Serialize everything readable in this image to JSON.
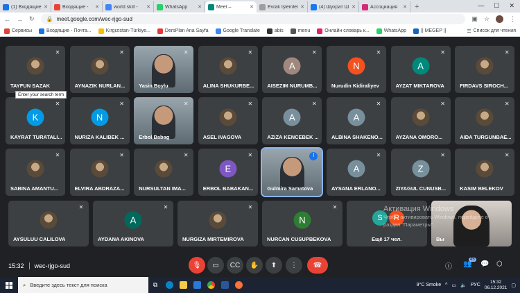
{
  "browser": {
    "tabs": [
      {
        "label": "(1) Входящие - ",
        "color": "#1a73e8"
      },
      {
        "label": "Входящие - ",
        "color": "#ea4335"
      },
      {
        "label": "world skill - ",
        "color": "#4285f4"
      },
      {
        "label": "WhatsApp",
        "color": "#25d366"
      },
      {
        "label": "Meet – ",
        "color": "#00897b",
        "active": true
      },
      {
        "label": "Evrak İşlemleri",
        "color": "#9e9e9e"
      },
      {
        "label": "(4) Шухрат Ш...",
        "color": "#1877f2"
      },
      {
        "label": "Ассоциация ",
        "color": "#d62976"
      }
    ],
    "address": "meet.google.com/wec-rjgo-sud",
    "bookmarks": [
      {
        "label": "Сервисы",
        "color": "#db4437"
      },
      {
        "label": "Входящие - Почта...",
        "color": "#1a73e8"
      },
      {
        "label": "Kırgızistan-Türkiye...",
        "color": "#fbbc04"
      },
      {
        "label": "DersPlan Ana Sayfa",
        "color": "#e53935"
      },
      {
        "label": "Google Translate",
        "color": "#4285f4"
      },
      {
        "label": "abis",
        "color": "#333333"
      },
      {
        "label": "menu",
        "color": "#555555"
      },
      {
        "label": "Онлайн словарь к...",
        "color": "#e91e63"
      },
      {
        "label": "WhatsApp",
        "color": "#25d366"
      },
      {
        "label": "|| MEGEP ||",
        "color": "#1565c0"
      }
    ],
    "reading_list": "Список для чтения"
  },
  "tooltip": "Enter your search term",
  "participants": [
    {
      "name": "TAYFUN SAZAK",
      "type": "photo"
    },
    {
      "name": "AYNAZIK NURLAN...",
      "type": "photo"
    },
    {
      "name": "Yasin Boylu",
      "type": "video"
    },
    {
      "name": "ALINA SHUKURBE...",
      "type": "photo"
    },
    {
      "name": "AISEZIM NURUMB...",
      "type": "letter",
      "letter": "A",
      "color": "#a1887f"
    },
    {
      "name": "Nurudin Kidiraliyev",
      "type": "letter",
      "letter": "N",
      "color": "#f4511e"
    },
    {
      "name": "AYZAT MIKTAROVA",
      "type": "letter",
      "letter": "A",
      "color": "#00897b"
    },
    {
      "name": "FIRDAVS SIROCH...",
      "type": "photo"
    },
    {
      "name": "KAYRAT TURATALI...",
      "type": "letter",
      "letter": "K",
      "color": "#039be5"
    },
    {
      "name": "NURIZA KALIBEK ...",
      "type": "letter",
      "letter": "N",
      "color": "#039be5"
    },
    {
      "name": "Erbol Babag",
      "type": "video"
    },
    {
      "name": "ASEL IVAGOVA",
      "type": "photo"
    },
    {
      "name": "AZIZA KENCEBEK ...",
      "type": "letter",
      "letter": "A",
      "color": "#78909c"
    },
    {
      "name": "ALBINA SHAKENO...",
      "type": "letter",
      "letter": "A",
      "color": "#78909c"
    },
    {
      "name": "AYZANA OMORO...",
      "type": "photo"
    },
    {
      "name": "AIDA TURGUNBAE...",
      "type": "photo"
    },
    {
      "name": "SABINA AMANTU...",
      "type": "photo"
    },
    {
      "name": "ELVIRA ABDRAZA...",
      "type": "photo"
    },
    {
      "name": "NURSULTAN IMA...",
      "type": "photo"
    },
    {
      "name": "ERBOL BABAKAN...",
      "type": "letter",
      "letter": "E",
      "color": "#7e57c2"
    },
    {
      "name": "Gulmira Samatova",
      "type": "video",
      "speaking": true
    },
    {
      "name": "AYSANA ERLANO...",
      "type": "letter",
      "letter": "A",
      "color": "#78909c"
    },
    {
      "name": "ZIYAGUL CUNUSB...",
      "type": "letter",
      "letter": "Z",
      "color": "#78909c"
    },
    {
      "name": "KASIM BELEKOV",
      "type": "photo"
    },
    {
      "name": "AYSULUU CALILOVA",
      "type": "photo"
    },
    {
      "name": "AYDANA AKINOVA",
      "type": "letter",
      "letter": "A",
      "color": "#00695c"
    },
    {
      "name": "NURGIZA MIRTEMIROVA",
      "type": "photo"
    },
    {
      "name": "NURCAN CUSUPBEKOVA",
      "type": "letter",
      "letter": "N",
      "color": "#2e7d32"
    }
  ],
  "more_tile": {
    "label": "Ещё 17 чел.",
    "avatars": [
      {
        "letter": "S",
        "color": "#26a69a"
      },
      {
        "letter": "R",
        "color": "#f4511e"
      }
    ]
  },
  "self_tile": {
    "name": "Вы"
  },
  "meeting": {
    "time": "15:32",
    "code": "wec-rjgo-sud",
    "participant_count": "45"
  },
  "watermark": {
    "title": "Активация Windows",
    "line1": "Чтобы активировать Windows, перейдите в",
    "line2": "раздел \"Параметры\"."
  },
  "taskbar": {
    "search_placeholder": "Введите здесь текст для поиска",
    "weather": "9°C  Smoke",
    "lang": "РУС",
    "time": "15:32",
    "date": "06.12.2021"
  }
}
